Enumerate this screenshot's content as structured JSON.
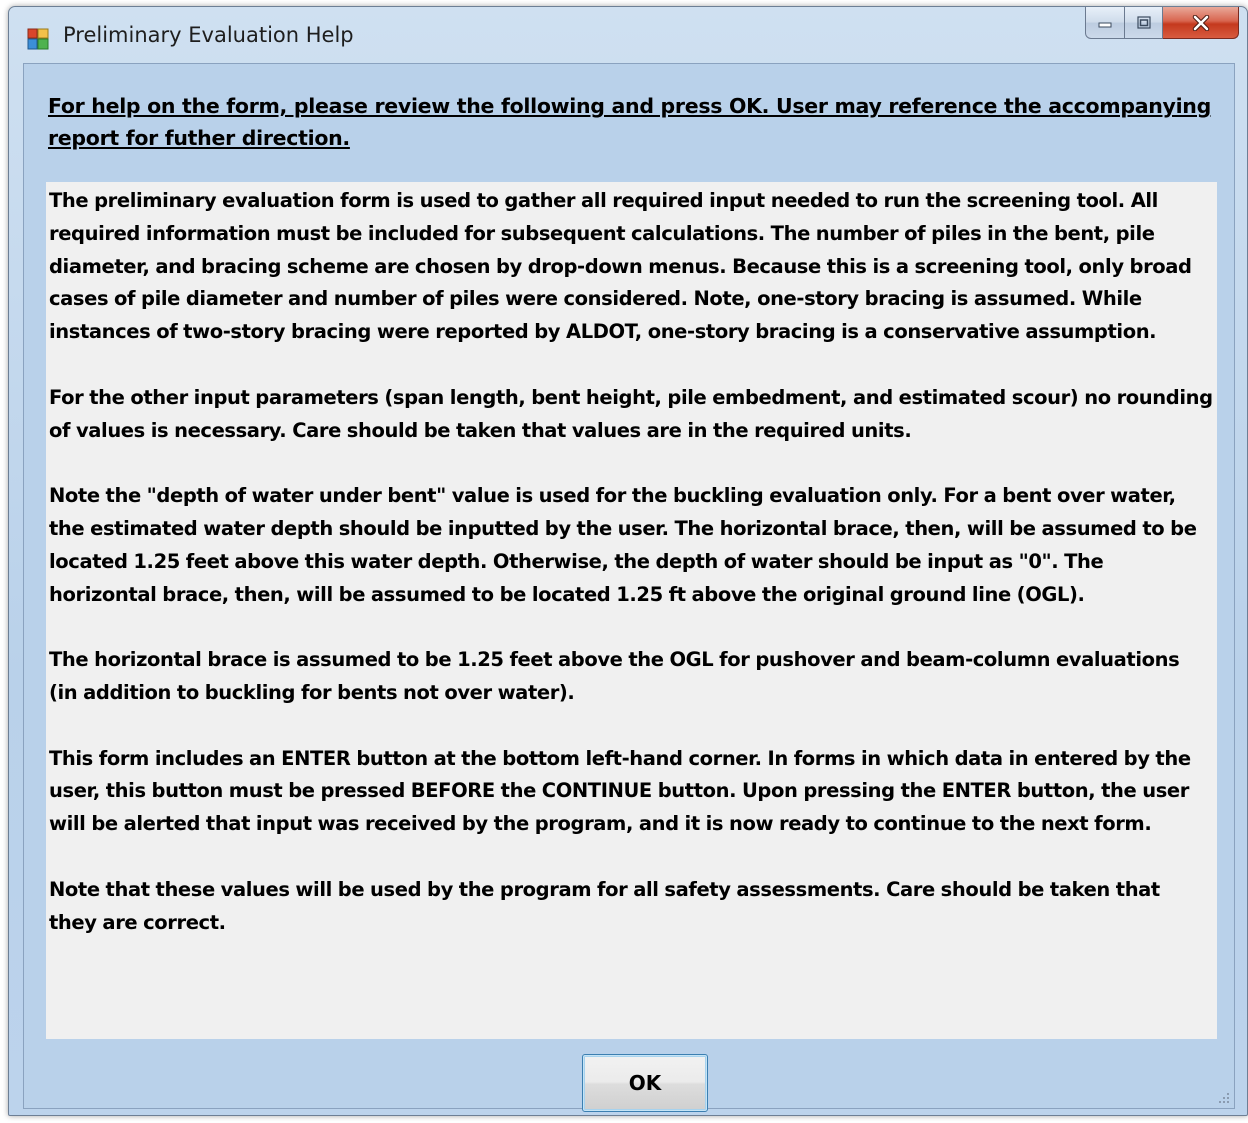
{
  "window": {
    "title": "Preliminary Evaluation Help"
  },
  "heading": "For help on the form, please review the following and press OK.  User may reference the accompanying report for futher direction.",
  "paragraphs": [
    "The preliminary evaluation form is used to gather all required input needed to run the screening tool. All required information must be included for subsequent calculations.  The number of piles in the bent, pile diameter, and bracing scheme are chosen by drop-down menus.  Because this is a screening tool, only broad cases of pile diameter and number of piles were considered.  Note, one-story bracing is assumed.  While instances of two-story bracing were reported by ALDOT, one-story bracing is a conservative assumption.",
    "For the other input parameters (span length, bent height, pile embedment, and estimated scour) no rounding of values is necessary.  Care should be taken that values are in the required units.",
    "Note the \"depth of water under bent\" value is used for the buckling evaluation only.  For a bent over water, the estimated water depth should be inputted by the user.  The horizontal brace, then, will be assumed to be located 1.25 feet above this water depth.  Otherwise, the depth of water should be input as \"0\".  The horizontal brace, then, will be assumed to be located 1.25 ft above the original ground line (OGL).",
    "The horizontal brace is assumed to be 1.25 feet above the OGL for pushover and beam-column evaluations (in addition to buckling for bents not over water).",
    "This form includes an ENTER button at the bottom left-hand corner.  In forms in which data in entered by the user, this button must be pressed BEFORE the CONTINUE button.  Upon pressing the ENTER button, the user will be alerted that input was received by the program, and it is now ready to continue to the next form.",
    "Note that these values will be used by the program for all safety assessments.  Care should be taken that they are correct."
  ],
  "buttons": {
    "ok": "OK"
  },
  "colors": {
    "form_background": "#b9d1ea",
    "textbox_background": "#f0f0f0",
    "close_button": "#c4391e"
  },
  "icons": {
    "app": "form-icon",
    "minimize": "minimize-icon",
    "maximize": "maximize-icon",
    "close": "close-icon",
    "resize": "resize-grip-icon"
  }
}
